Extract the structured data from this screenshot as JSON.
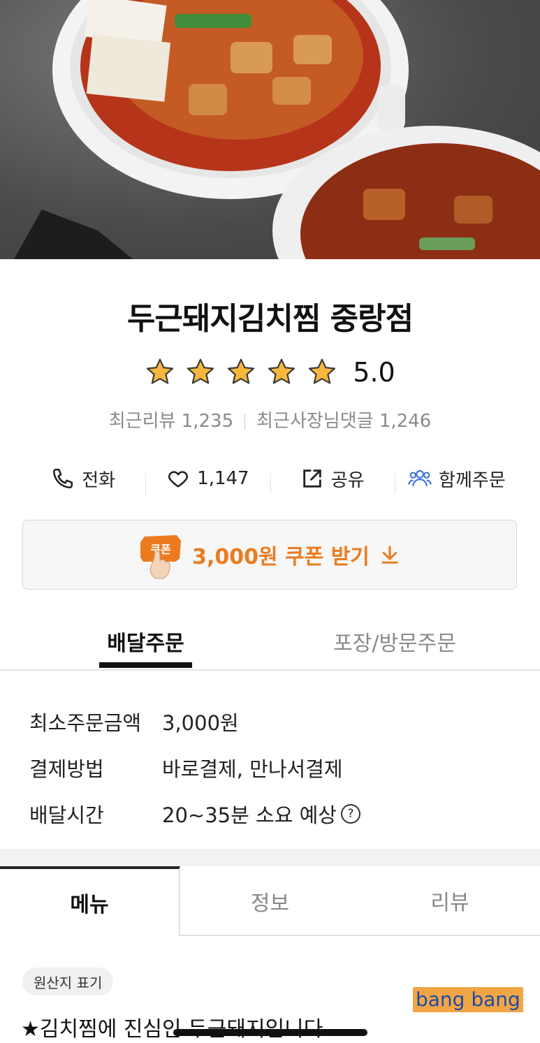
{
  "store": {
    "name": "두근돼지김치찜 중랑점",
    "rating": "5.0",
    "rating_value": 5,
    "recent_reviews_label": "최근리뷰 1,235",
    "owner_replies_label": "최근사장님댓글 1,246"
  },
  "actions": {
    "call": "전화",
    "likes": "1,147",
    "share": "공유",
    "group_order": "함께주문"
  },
  "coupon": {
    "badge": "쿠폰",
    "label": "3,000원 쿠폰 받기"
  },
  "order_tabs": {
    "delivery": "배달주문",
    "pickup": "포장/방문주문"
  },
  "info": {
    "min_order_key": "최소주문금액",
    "min_order_val": "3,000원",
    "payment_key": "결제방법",
    "payment_val": "바로결제, 만나서결제",
    "delivery_time_key": "배달시간",
    "delivery_time_val": "20~35분 소요 예상"
  },
  "main_tabs": {
    "menu": "메뉴",
    "info": "정보",
    "reviews": "리뷰"
  },
  "origin_chip": "원산지 표기",
  "notice": "★김치찜에 진심인 두근돼지입니다",
  "watermark": "bang bang",
  "colors": {
    "accent_orange": "#ec7b1f",
    "group_icon_blue": "#3a6fe0",
    "star_gold": "#f6b73c"
  }
}
